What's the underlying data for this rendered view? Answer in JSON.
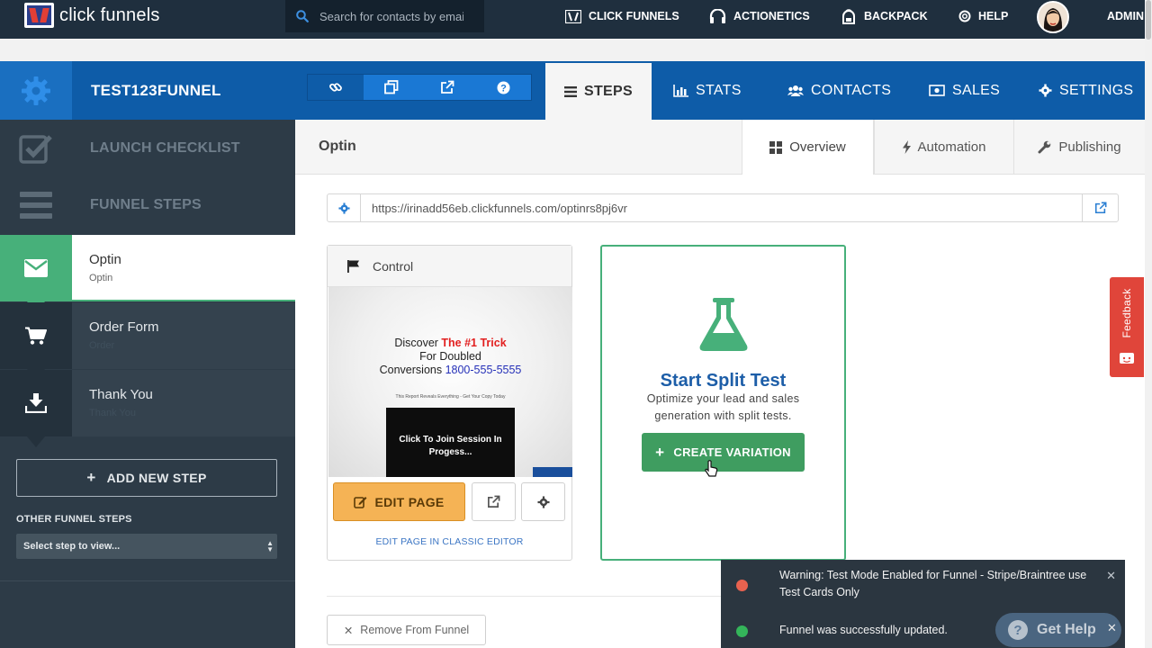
{
  "app": {
    "logo_text": "click funnels"
  },
  "search": {
    "placeholder": "Search for contacts by email"
  },
  "topnav": {
    "items": [
      {
        "label": "CLICK FUNNELS",
        "icon": "clickfunnels-logo-icon"
      },
      {
        "label": "ACTIONETICS",
        "icon": "headset-icon"
      },
      {
        "label": "BACKPACK",
        "icon": "backpack-icon"
      },
      {
        "label": "HELP",
        "icon": "lifebuoy-icon"
      }
    ],
    "admin_label": "ADMIN"
  },
  "funnel": {
    "name": "TEST123FUNNEL",
    "tools": [
      "link-icon",
      "copy-icon",
      "external-link-icon",
      "question-icon"
    ],
    "tabs": [
      {
        "label": "STEPS",
        "icon": "list-icon",
        "active": true
      },
      {
        "label": "STATS",
        "icon": "bar-chart-icon"
      },
      {
        "label": "CONTACTS",
        "icon": "users-icon"
      },
      {
        "label": "SALES",
        "icon": "money-icon"
      },
      {
        "label": "SETTINGS",
        "icon": "gear-icon"
      }
    ]
  },
  "sidebar": {
    "launch_checklist": "LAUNCH CHECKLIST",
    "funnel_steps": "FUNNEL STEPS",
    "steps": [
      {
        "title": "Optin",
        "subtitle": "Optin",
        "icon": "envelope-icon",
        "active": true
      },
      {
        "title": "Order Form",
        "subtitle": "Order",
        "icon": "cart-icon"
      },
      {
        "title": "Thank You",
        "subtitle": "Thank You",
        "icon": "download-icon"
      }
    ],
    "add_step_label": "ADD NEW STEP",
    "other_steps_label": "OTHER FUNNEL STEPS",
    "select_value": "Select step to view..."
  },
  "main": {
    "page_title": "Optin",
    "subtabs": [
      {
        "label": "Overview",
        "icon": "grid-icon",
        "active": true
      },
      {
        "label": "Automation",
        "icon": "bolt-icon"
      },
      {
        "label": "Publishing",
        "icon": "wrench-icon"
      }
    ],
    "url": "https://irinadd56eb.clickfunnels.com/optinrs8pj6vr",
    "control": {
      "label": "Control",
      "preview": {
        "line1_pre": "Discover ",
        "line1_red": "The #1 Trick",
        "line2": "For Doubled",
        "line3_pre": "Conversions ",
        "line3_blue": "1800-555-5555",
        "small": "This Report Reveals Everything - Get Your Copy Today",
        "video": "Click To Join Session In Progess..."
      },
      "edit_label": "EDIT PAGE",
      "classic_label": "EDIT PAGE IN CLASSIC EDITOR"
    },
    "split": {
      "title": "Start Split Test",
      "description": "Optimize your lead and sales generation with split tests.",
      "button_label": "CREATE VARIATION"
    },
    "remove_label": "Remove From Funnel"
  },
  "feedback": {
    "label": "Feedback"
  },
  "toasts": [
    {
      "text": "Warning: Test Mode Enabled for Funnel - Stripe/Braintree use Test Cards Only",
      "color": "#e8624f"
    },
    {
      "text": "Funnel was successfully updated.",
      "color": "#34b55a"
    }
  ],
  "gethelp": {
    "label": "Get Help"
  },
  "colors": {
    "topbar": "#1f2f3e",
    "header": "#0e5ca8",
    "sidebar": "#2d3b47",
    "accent_green": "#47b07a",
    "edit_orange": "#f5b355"
  }
}
